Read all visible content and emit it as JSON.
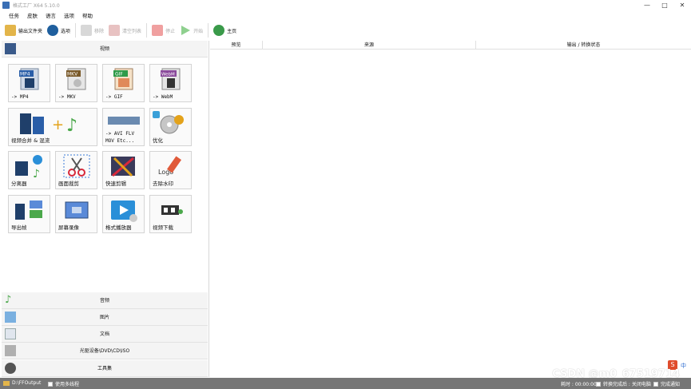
{
  "window": {
    "title": "格式工厂 X64 5.10.0",
    "buttons": [
      "—",
      "□",
      "✕"
    ]
  },
  "menu": [
    "任务",
    "皮肤",
    "语言",
    "选项",
    "帮助"
  ],
  "toolbar": {
    "output_folder": "输出文件夹",
    "options": "选项",
    "remove": "移除",
    "clear_list": "清空列表",
    "stop": "停止",
    "start": "开始",
    "home": "主页"
  },
  "categories": {
    "video": "视频",
    "audio": "音频",
    "image": "图片",
    "document": "文档",
    "rom": "光驱设备\\DVD\\CD\\ISO",
    "toolbox": "工具集"
  },
  "tiles": [
    {
      "label": "-> MP4",
      "badge": "MP4",
      "color": "#2a5ea8"
    },
    {
      "label": "-> MKV",
      "badge": "MKV",
      "color": "#7a5a2a"
    },
    {
      "label": "-> GIF",
      "badge": "GIF",
      "color": "#2f9b4a"
    },
    {
      "label": "-> WebM",
      "badge": "WebM",
      "color": "#8a4a9b"
    },
    {
      "label": "视频合并 & 混流"
    },
    {
      "label": "-> AVI FLV",
      "label2": "MOV Etc..."
    },
    {
      "label": "优化"
    },
    {
      "label": "分离器"
    },
    {
      "label": "画面裁剪"
    },
    {
      "label": "快速剪辑"
    },
    {
      "label": "去除水印",
      "logo_text": "Logo"
    },
    {
      "label": "导出帧"
    },
    {
      "label": "屏幕录像"
    },
    {
      "label": "格式播放器"
    },
    {
      "label": "视频下载"
    }
  ],
  "columns": {
    "preview": "预览",
    "source": "来源",
    "output": "输出 / 转换状态"
  },
  "status": {
    "output_path": "D:\\FFOutput",
    "multithread": "使用多线程",
    "elapsed": "耗时 : 00:00:00",
    "after_convert": "转换完成后 : 关闭电脑",
    "notify": "完成通知"
  },
  "watermark": "CSDN @m0_67519714",
  "brand_s": "S",
  "brand_zh": "中"
}
